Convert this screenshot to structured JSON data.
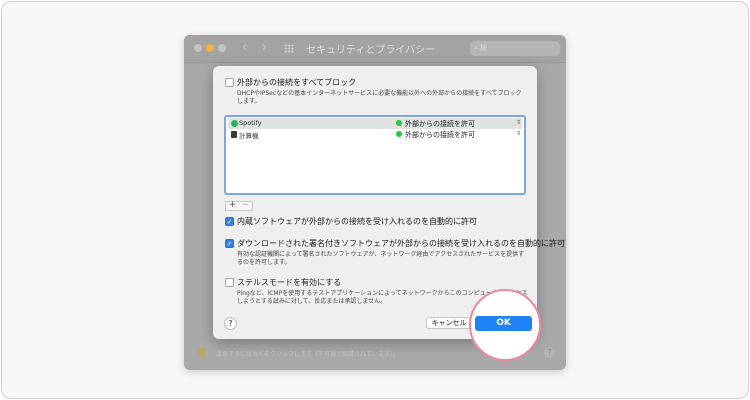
{
  "window": {
    "title": "セキュリティとプライバシー",
    "search_placeholder": "検",
    "footer_text": "変更するにはカギをクリックします（不可視で保護されています）。",
    "footer_help": "?"
  },
  "sheet": {
    "block_all": {
      "label": "外部からの接続をすべてブロック",
      "description": "DHCPやIPSecなどの基本インターネットサービスに必要な機能以外への外部からの接続をすべてブロックします。",
      "checked": false
    },
    "apps": [
      {
        "name": "Spotify",
        "status": "外部からの接続を許可",
        "icon_color": "#1db954",
        "selected": true
      },
      {
        "name": "計算機",
        "status": "外部からの接続を許可",
        "icon_color": "#3a3a3a",
        "selected": false
      }
    ],
    "add_label": "+",
    "remove_label": "−",
    "builtin": {
      "label": "内蔵ソフトウェアが外部からの接続を受け入れるのを自動的に許可",
      "checked": true
    },
    "signed": {
      "label": "ダウンロードされた署名付きソフトウェアが外部からの接続を受け入れるのを自動的に許可",
      "description": "有効な認証機関によって署名されたソフトウェアが、ネットワーク経由でアクセスされたサービスを提供するのを許可します。",
      "checked": true
    },
    "stealth": {
      "label": "ステルスモードを有効にする",
      "description": "Pingなど、ICMPを使用するテストアプリケーションによってネットワークからこのコンピュータにアクセスしようとする試みに対して、反応または承認しません。",
      "checked": false
    },
    "help_label": "?",
    "cancel_label": "キャンセル",
    "ok_label": "OK"
  },
  "colors": {
    "accent": "#1f83f5",
    "highlight_ring": "#e98a9d",
    "status_green": "#28c940"
  }
}
